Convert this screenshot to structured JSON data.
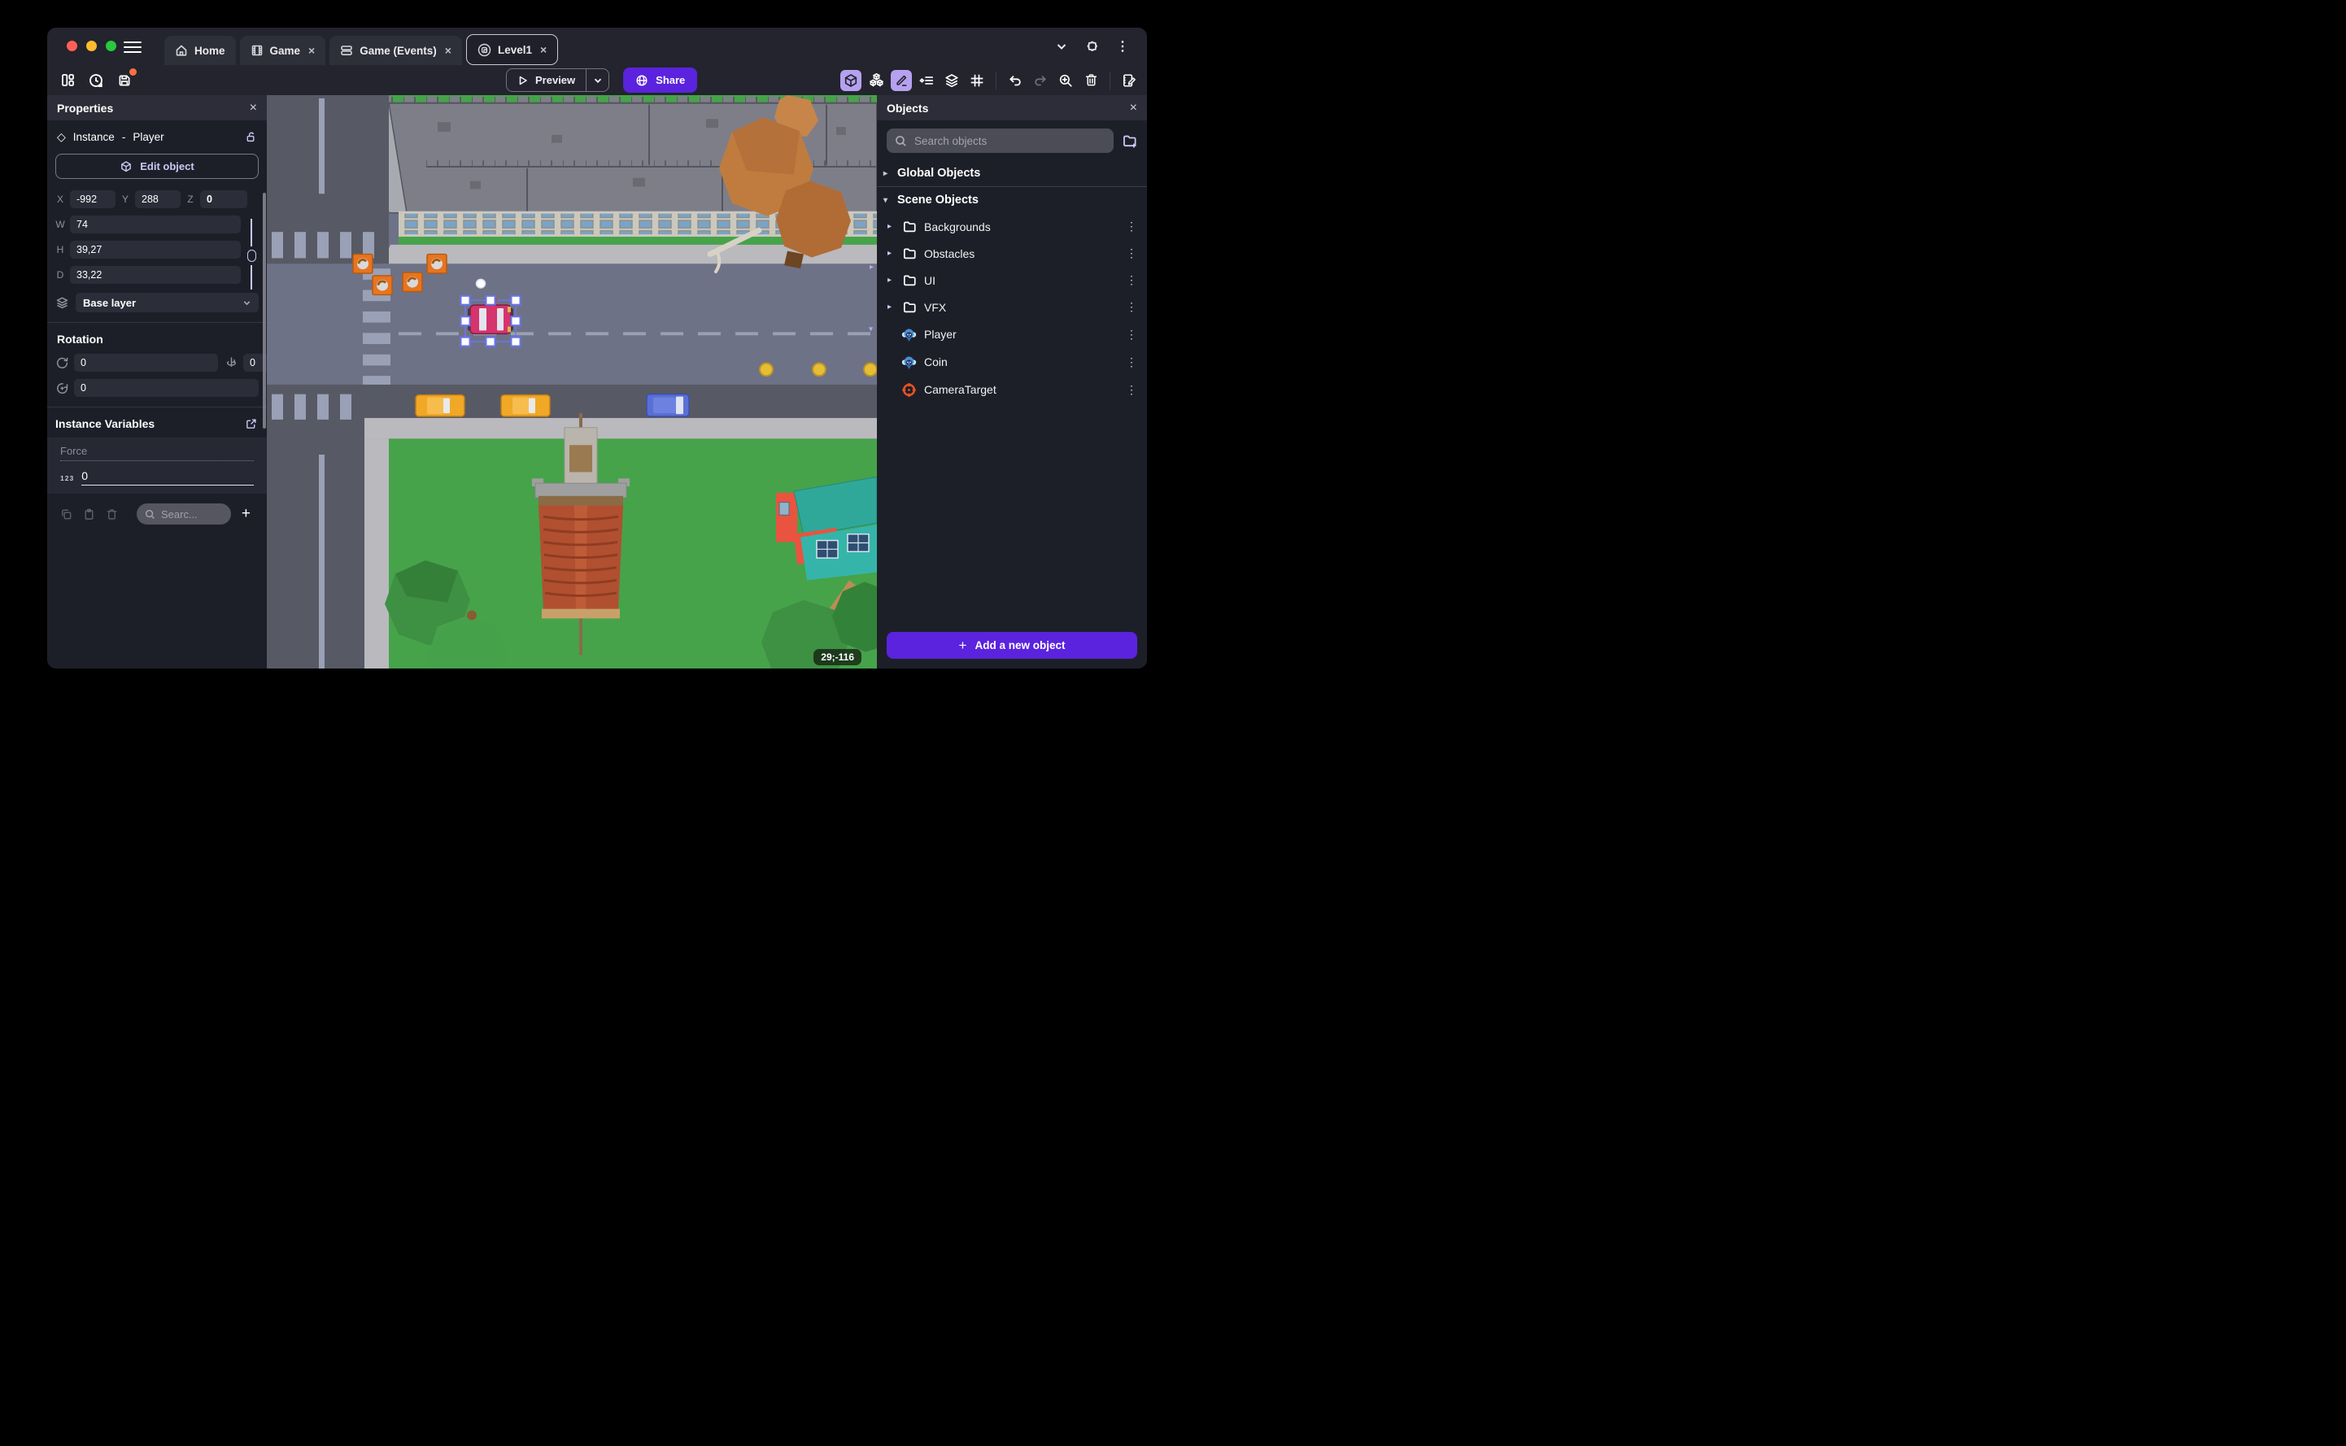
{
  "window": {
    "tabs": [
      {
        "label": "Home"
      },
      {
        "label": "Game"
      },
      {
        "label": "Game (Events)"
      },
      {
        "label": "Level1"
      }
    ],
    "close_symbol": "×"
  },
  "toolbar": {
    "preview_label": "Preview",
    "share_label": "Share"
  },
  "properties": {
    "title": "Properties",
    "close_symbol": "×",
    "diamond_symbol": "◇",
    "instance_label": "Instance",
    "separator": "-",
    "instance_name": "Player",
    "edit_object_label": "Edit object",
    "x_label": "X",
    "x_value": "-992",
    "y_label": "Y",
    "y_value": "288",
    "z_label": "Z",
    "z_value": "0",
    "w_label": "W",
    "w_value": "74",
    "h_label": "H",
    "h_value": "39,27",
    "d_label": "D",
    "d_value": "33,22",
    "layer_value": "Base layer",
    "rotation_title": "Rotation",
    "rotation_x": "0",
    "rotation_y": "0",
    "rotation_z": "0",
    "variables_title": "Instance Variables",
    "variable_name": "Force",
    "variable_type": "123",
    "variable_value": "0",
    "variables_search_placeholder": "Searc...",
    "add_symbol": "+"
  },
  "objects": {
    "title": "Objects",
    "close_symbol": "×",
    "search_placeholder": "Search objects",
    "global_section": "Global Objects",
    "scene_section": "Scene Objects",
    "collapsed_chevron": "▸",
    "expanded_chevron": "▾",
    "menu_symbol": "⋮",
    "folders": [
      {
        "label": "Backgrounds"
      },
      {
        "label": "Obstacles"
      },
      {
        "label": "UI"
      },
      {
        "label": "VFX"
      }
    ],
    "items": [
      {
        "label": "Player"
      },
      {
        "label": "Coin"
      },
      {
        "label": "CameraTarget"
      }
    ],
    "add_button_label": "Add a new object"
  },
  "canvas": {
    "coordinates_badge": "29;-116"
  },
  "colors": {
    "accent_purple": "#5b23dd",
    "accent_lavender": "#b5a1f0",
    "selection_blue": "#6a74f0",
    "unsaved_dot": "#ff7043",
    "traffic_red": "#ff5f57",
    "traffic_yellow": "#febc2e",
    "traffic_green": "#28c840"
  }
}
